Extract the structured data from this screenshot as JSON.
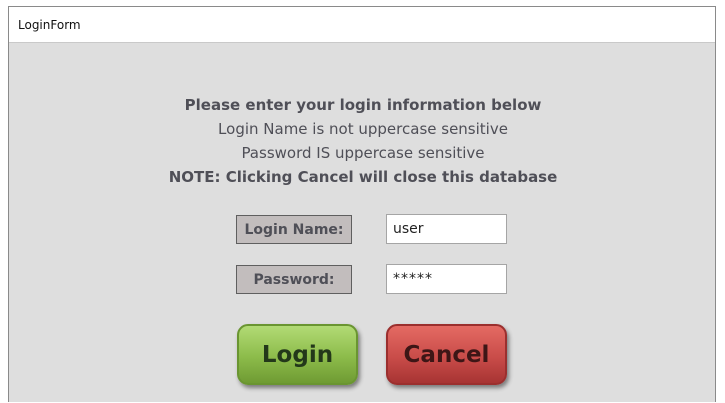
{
  "window": {
    "title": "LoginForm"
  },
  "messages": {
    "line1": "Please enter your login information below",
    "line2": "Login Name is not uppercase sensitive",
    "line3": "Password IS uppercase sensitive",
    "line4": "NOTE: Clicking Cancel will close this database"
  },
  "form": {
    "login_label": "Login Name:",
    "login_value": "user",
    "password_label": "Password:",
    "password_value": "*****"
  },
  "buttons": {
    "login": "Login",
    "cancel": "Cancel"
  },
  "colors": {
    "login_button": "#8cbb4a",
    "cancel_button": "#c94c49",
    "label_box": "#c2bdbd",
    "background": "#dedede"
  }
}
